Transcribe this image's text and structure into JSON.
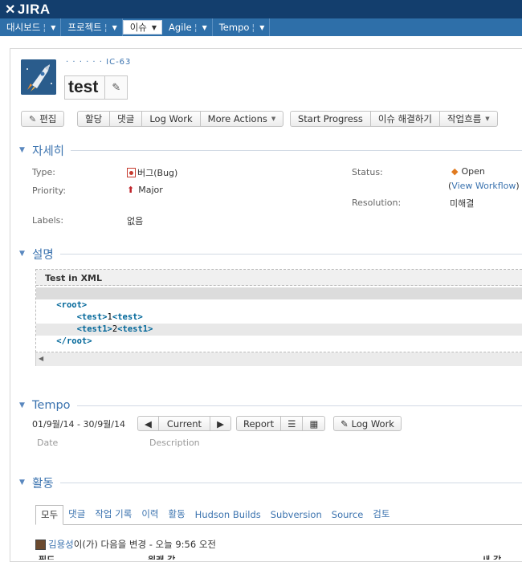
{
  "header": {
    "logo_text": "JIRA"
  },
  "nav": [
    {
      "label": "대시보드"
    },
    {
      "label": "프로젝트"
    },
    {
      "label": "이슈"
    },
    {
      "label": "Agile"
    },
    {
      "label": "Tempo"
    }
  ],
  "issue": {
    "breadcrumb": "· · · · · · IC-63",
    "summary": "test"
  },
  "toolbar": {
    "edit": "편집",
    "assign": "할당",
    "comment": "댓글",
    "log_work": "Log Work",
    "more_actions": "More Actions",
    "start_progress": "Start Progress",
    "resolve": "이슈 해결하기",
    "workflow": "작업흐름"
  },
  "details": {
    "title": "자세히",
    "type_label": "Type:",
    "type_value": "버그(Bug)",
    "priority_label": "Priority:",
    "priority_value": "Major",
    "labels_label": "Labels:",
    "labels_value": "없음",
    "status_label": "Status:",
    "status_value": "Open",
    "view_workflow_open": "(",
    "view_workflow": "View Workflow",
    "view_workflow_close": ")",
    "resolution_label": "Resolution:",
    "resolution_value": "미해결"
  },
  "description": {
    "title": "설명",
    "code_title": "Test in XML",
    "code_lines": [
      {
        "indent": "    ",
        "open": "<",
        "tag": "root",
        "close": ">",
        "text": "",
        "tag2": "",
        "open2": "",
        "close2": ""
      },
      {
        "indent": "        ",
        "open": "<",
        "tag": "test",
        "close": ">",
        "text": "1",
        "open2": "<",
        "tag2": "test",
        "close2": ">"
      },
      {
        "indent": "        ",
        "open": "<",
        "tag": "test1",
        "close": ">",
        "text": "2",
        "open2": "<",
        "tag2": "test1",
        "close2": ">"
      },
      {
        "indent": "    ",
        "open": "</",
        "tag": "root",
        "close": ">",
        "text": "",
        "tag2": "",
        "open2": "",
        "close2": ""
      }
    ]
  },
  "tempo": {
    "title": "Tempo",
    "date_range": "01/9월/14 - 30/9월/14",
    "current": "Current",
    "report": "Report",
    "log_work": "Log Work",
    "col_date": "Date",
    "col_description": "Description"
  },
  "activity": {
    "title": "활동",
    "tabs": [
      "모두",
      "댓글",
      "작업 기록",
      "이력",
      "활동",
      "Hudson Builds",
      "Subversion",
      "Source",
      "검토"
    ],
    "user": "김용성",
    "entry_text": " 이(가) 다음을 변경 - 오늘 9:56 오전",
    "col_field": "필드",
    "col_original": "원래 값",
    "col_new": "새 값"
  }
}
